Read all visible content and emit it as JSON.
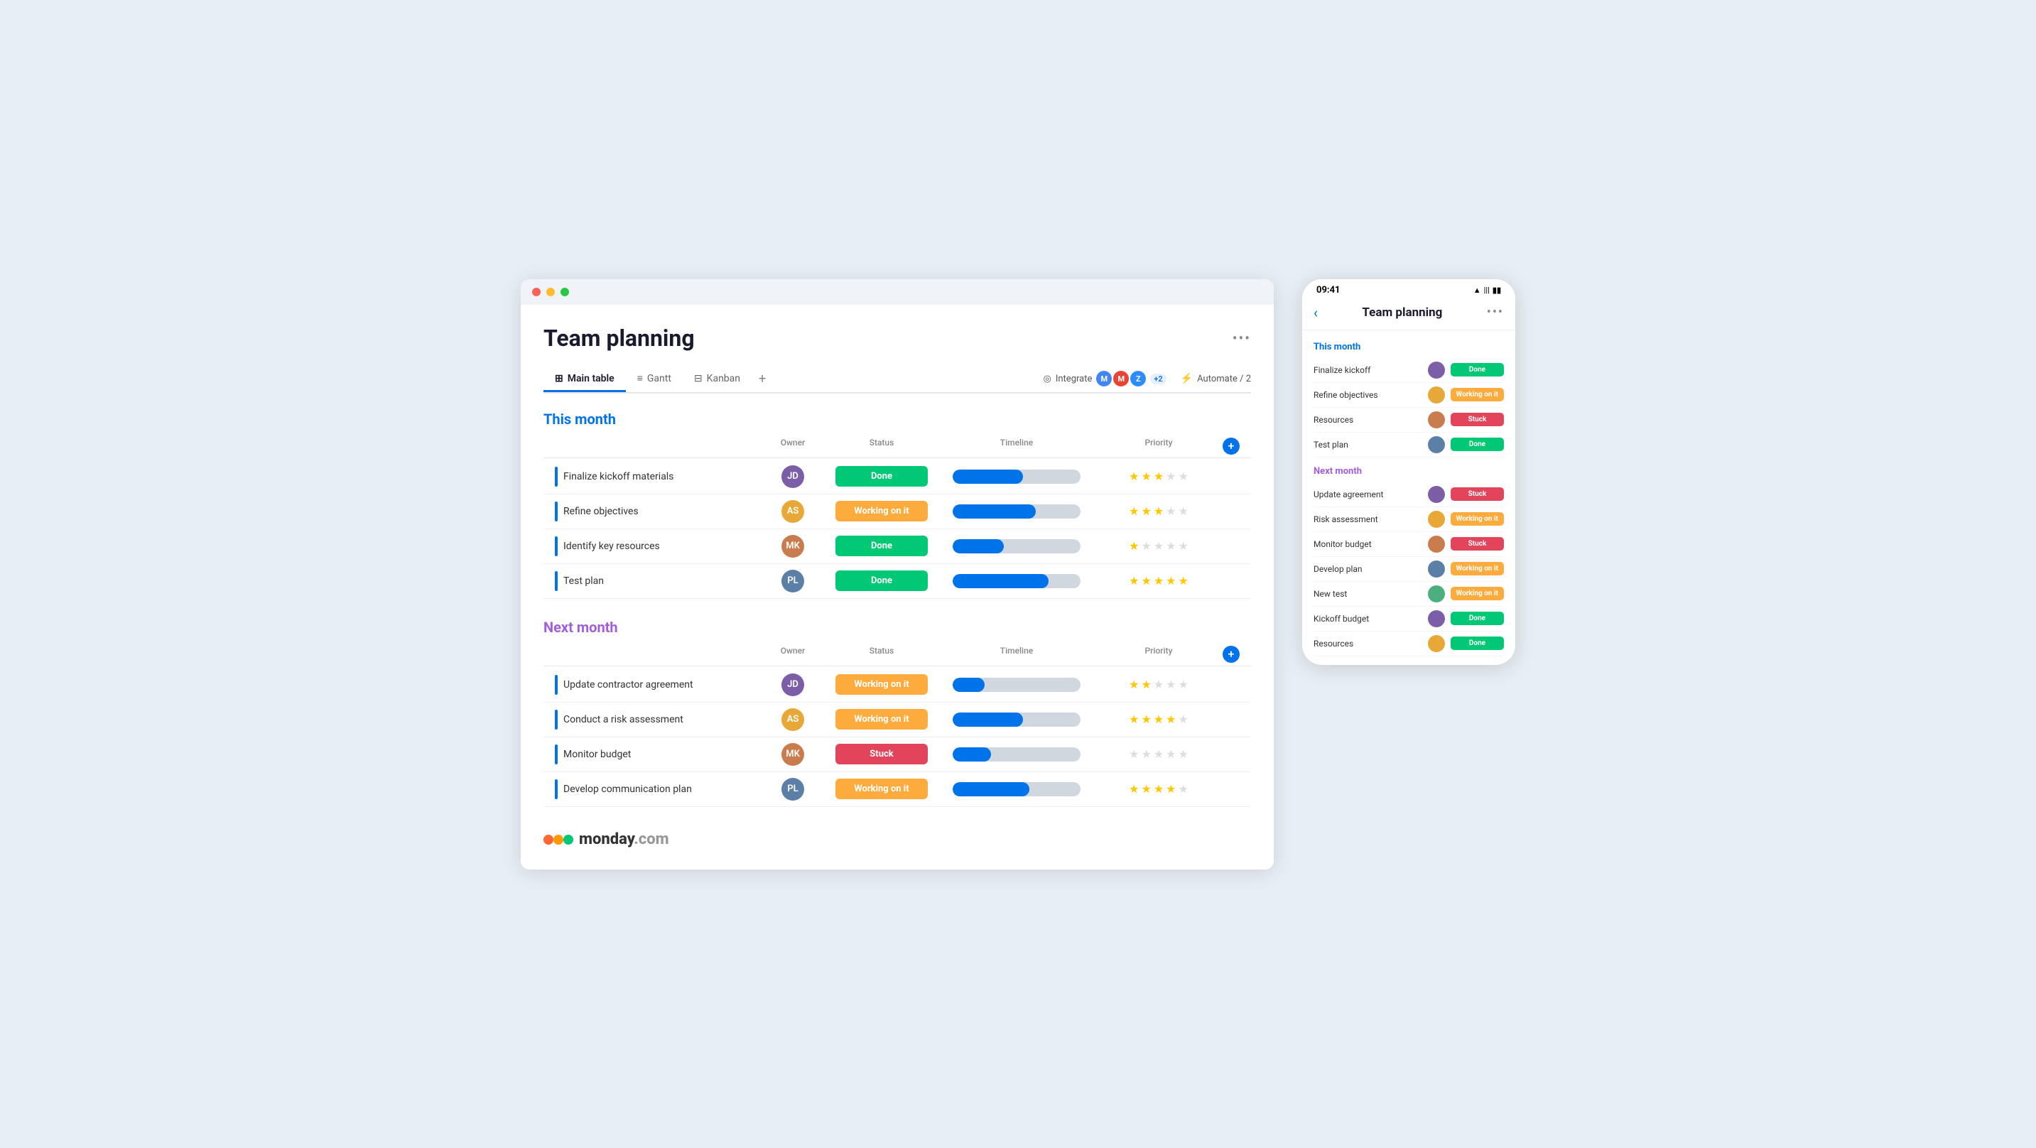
{
  "app": {
    "title": "Team planning",
    "more_options_label": "•••"
  },
  "tabs": {
    "items": [
      {
        "id": "main-table",
        "label": "Main table",
        "icon": "⊞",
        "active": true
      },
      {
        "id": "gantt",
        "label": "Gantt",
        "icon": "≡",
        "active": false
      },
      {
        "id": "kanban",
        "label": "Kanban",
        "icon": "⊟",
        "active": false
      }
    ],
    "add_label": "+",
    "integrate_label": "Integrate",
    "integrate_count": "+2",
    "automate_label": "Automate / 2"
  },
  "this_month": {
    "section_title": "This month",
    "columns": {
      "owner": "Owner",
      "status": "Status",
      "timeline": "Timeline",
      "priority": "Priority"
    },
    "rows": [
      {
        "task": "Finalize kickoff materials",
        "owner_initials": "JD",
        "owner_color": "avatar-1",
        "status": "Done",
        "status_class": "status-done",
        "timeline_pct": 55,
        "priority_stars": 3,
        "priority_total": 5
      },
      {
        "task": "Refine objectives",
        "owner_initials": "AS",
        "owner_color": "avatar-2",
        "status": "Working on it",
        "status_class": "status-working",
        "timeline_pct": 65,
        "priority_stars": 3,
        "priority_total": 5
      },
      {
        "task": "Identify key resources",
        "owner_initials": "MK",
        "owner_color": "avatar-3",
        "status": "Done",
        "status_class": "status-done",
        "timeline_pct": 40,
        "priority_stars": 1,
        "priority_total": 5
      },
      {
        "task": "Test plan",
        "owner_initials": "PL",
        "owner_color": "avatar-4",
        "status": "Done",
        "status_class": "status-done",
        "timeline_pct": 75,
        "priority_stars": 5,
        "priority_total": 5
      }
    ]
  },
  "next_month": {
    "section_title": "Next month",
    "columns": {
      "owner": "Owner",
      "status": "Status",
      "timeline": "Timeline",
      "priority": "Priority"
    },
    "rows": [
      {
        "task": "Update contractor agreement",
        "owner_initials": "JD",
        "owner_color": "avatar-1",
        "status": "Working on it",
        "status_class": "status-working",
        "timeline_pct": 25,
        "priority_stars": 2,
        "priority_total": 5
      },
      {
        "task": "Conduct a risk assessment",
        "owner_initials": "AS",
        "owner_color": "avatar-2",
        "status": "Working on it",
        "status_class": "status-working",
        "timeline_pct": 55,
        "priority_stars": 4,
        "priority_total": 5
      },
      {
        "task": "Monitor budget",
        "owner_initials": "MK",
        "owner_color": "avatar-3",
        "status": "Stuck",
        "status_class": "status-stuck",
        "timeline_pct": 30,
        "priority_stars": 0,
        "priority_total": 5
      },
      {
        "task": "Develop communication plan",
        "owner_initials": "PL",
        "owner_color": "avatar-4",
        "status": "Working on it",
        "status_class": "status-working",
        "timeline_pct": 60,
        "priority_stars": 4,
        "priority_total": 5
      }
    ]
  },
  "mobile": {
    "time": "09:41",
    "title": "Team planning",
    "this_month_label": "This month",
    "next_month_label": "Next month",
    "this_month_rows": [
      {
        "task": "Finalize kickoff",
        "status": "Done",
        "status_class": "m-done",
        "owner_color": "avatar-1"
      },
      {
        "task": "Refine objectives",
        "status": "Working on it",
        "status_class": "m-working",
        "owner_color": "avatar-2"
      },
      {
        "task": "Resources",
        "status": "Stuck",
        "status_class": "m-stuck",
        "owner_color": "avatar-3"
      },
      {
        "task": "Test plan",
        "status": "Done",
        "status_class": "m-done",
        "owner_color": "avatar-4"
      }
    ],
    "next_month_rows": [
      {
        "task": "Update agreement",
        "status": "Stuck",
        "status_class": "m-stuck",
        "owner_color": "avatar-1"
      },
      {
        "task": "Risk assessment",
        "status": "Working on it",
        "status_class": "m-working",
        "owner_color": "avatar-2"
      },
      {
        "task": "Monitor budget",
        "status": "Stuck",
        "status_class": "m-stuck",
        "owner_color": "avatar-3"
      },
      {
        "task": "Develop plan",
        "status": "Working on it",
        "status_class": "m-working",
        "owner_color": "avatar-4"
      },
      {
        "task": "New test",
        "status": "Working on it",
        "status_class": "m-working",
        "owner_color": "avatar-5"
      },
      {
        "task": "Kickoff budget",
        "status": "Done",
        "status_class": "m-done",
        "owner_color": "avatar-1"
      },
      {
        "task": "Resources",
        "status": "Done",
        "status_class": "m-done",
        "owner_color": "avatar-2"
      }
    ]
  },
  "logo": {
    "text_monday": "monday",
    "text_com": ".com"
  }
}
